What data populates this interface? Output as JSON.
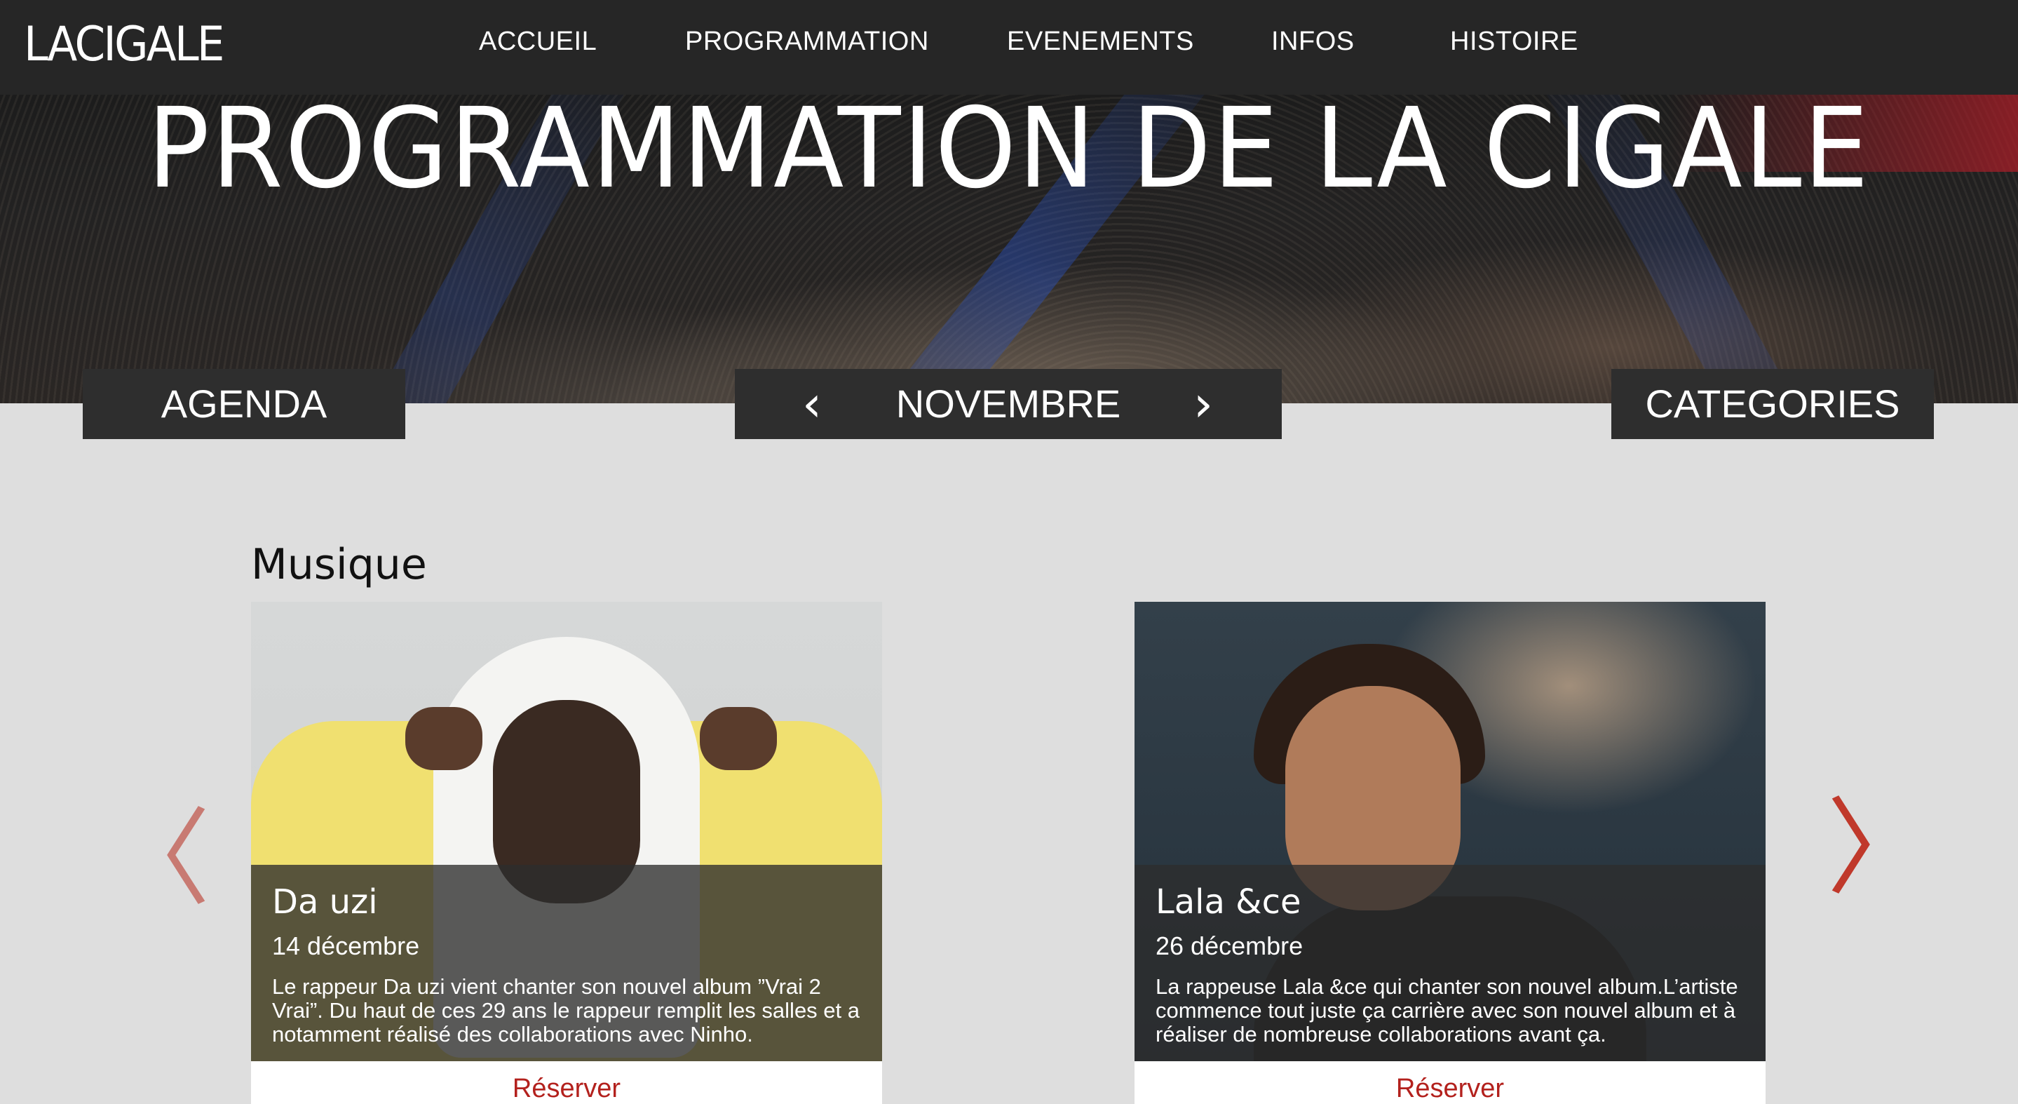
{
  "nav": {
    "logo": "LACIGALE",
    "items": [
      {
        "label": "ACCUEIL"
      },
      {
        "label": "PROGRAMMATION"
      },
      {
        "label": "EVENEMENTS"
      },
      {
        "label": "INFOS"
      },
      {
        "label": "HISTOIRE"
      }
    ]
  },
  "hero": {
    "title": "PROGRAMMATION DE LA CIGALE"
  },
  "subnav": {
    "agenda_label": "AGENDA",
    "month_label": "NOVEMBRE",
    "prev_glyph": "‹",
    "next_glyph": "›",
    "categories_label": "CATEGORIES"
  },
  "section": {
    "title": "Musique"
  },
  "cards": [
    {
      "name": "Da uzi",
      "date": "14 décembre",
      "description": "Le rappeur Da uzi vient chanter son nouvel album ”Vrai 2 Vrai”. Du haut de ces 29 ans le rappeur remplit les salles et a notamment réalisé des collaborations avec Ninho.",
      "reserve_label": "Réserver"
    },
    {
      "name": "Lala &ce",
      "date": "26 décembre",
      "description": "La rappeuse Lala &ce qui chanter son nouvel album.L’artiste commence tout juste ça carrière avec son nouvel album et à réaliser de nombreuse collaborations avant ça.",
      "reserve_label": "Réserver"
    }
  ],
  "carousel": {
    "prev_glyph": "〈",
    "next_glyph": "〉",
    "arrow_color": "#c0392b"
  },
  "colors": {
    "nav_bg": "#262626",
    "button_bg": "#2e2e2e",
    "page_bg": "#dedede",
    "reserve_text": "#b3211d"
  }
}
